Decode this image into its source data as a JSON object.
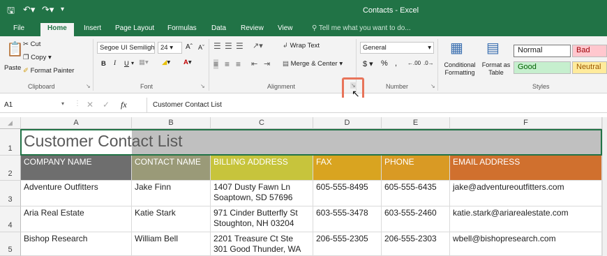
{
  "window": {
    "title": "Contacts - Excel"
  },
  "tabs": [
    "File",
    "Home",
    "Insert",
    "Page Layout",
    "Formulas",
    "Data",
    "Review",
    "View"
  ],
  "tell_me": "Tell me what you want to do...",
  "clipboard": {
    "paste": "Paste",
    "cut": "Cut",
    "copy": "Copy",
    "format_painter": "Format Painter",
    "label": "Clipboard"
  },
  "font": {
    "name": "Segoe UI Semiligh",
    "size": "24",
    "bold": "B",
    "italic": "I",
    "underline": "U",
    "label": "Font"
  },
  "alignment": {
    "wrap_text": "Wrap Text",
    "merge_center": "Merge & Center",
    "label": "Alignment"
  },
  "number": {
    "format": "General",
    "currency": "$",
    "percent": "%",
    "comma": ",",
    "inc_dec": ".00",
    "label": "Number"
  },
  "styles": {
    "conditional": "Conditional Formatting",
    "format_table": "Format as Table",
    "normal": "Normal",
    "bad": "Bad",
    "good": "Good",
    "neutral": "Neutral",
    "label": "Styles"
  },
  "formula_bar": {
    "name_box": "A1",
    "fx": "fx",
    "content": "Customer Contact List"
  },
  "columns": [
    "A",
    "B",
    "C",
    "D",
    "E",
    "F"
  ],
  "rows": [
    "1",
    "2",
    "3",
    "4",
    "5"
  ],
  "sheet": {
    "title": "Customer Contact List",
    "headers": [
      "COMPANY NAME",
      "CONTACT NAME",
      "BILLING ADDRESS",
      "FAX",
      "PHONE",
      "EMAIL ADDRESS"
    ],
    "data": [
      [
        "Adventure Outfitters",
        "Jake Finn",
        "1407 Dusty Fawn Ln",
        "Soaptown, SD 57696",
        "605-555-8495",
        "605-555-6435",
        "jake@adventureoutfitters.com"
      ],
      [
        "Aria Real Estate",
        "Katie Stark",
        "971 Cinder Butterfly St",
        "Stoughton, NH 03204",
        "603-555-3478",
        "603-555-2460",
        "katie.stark@ariarealestate.com"
      ],
      [
        "Bishop Research",
        "William Bell",
        "2201 Treasure Ct Ste",
        "301 Good Thunder, WA",
        "206-555-2305",
        "206-555-2303",
        "wbell@bishopresearch.com"
      ]
    ]
  },
  "colors": {
    "excel_green": "#217346",
    "col_a": "#6e6e6e",
    "col_b": "#9a9a78",
    "col_c": "#c7c43c",
    "col_d": "#d9a420",
    "col_e": "#d99a24",
    "col_f": "#d0702e",
    "highlight": "#e8745a"
  }
}
